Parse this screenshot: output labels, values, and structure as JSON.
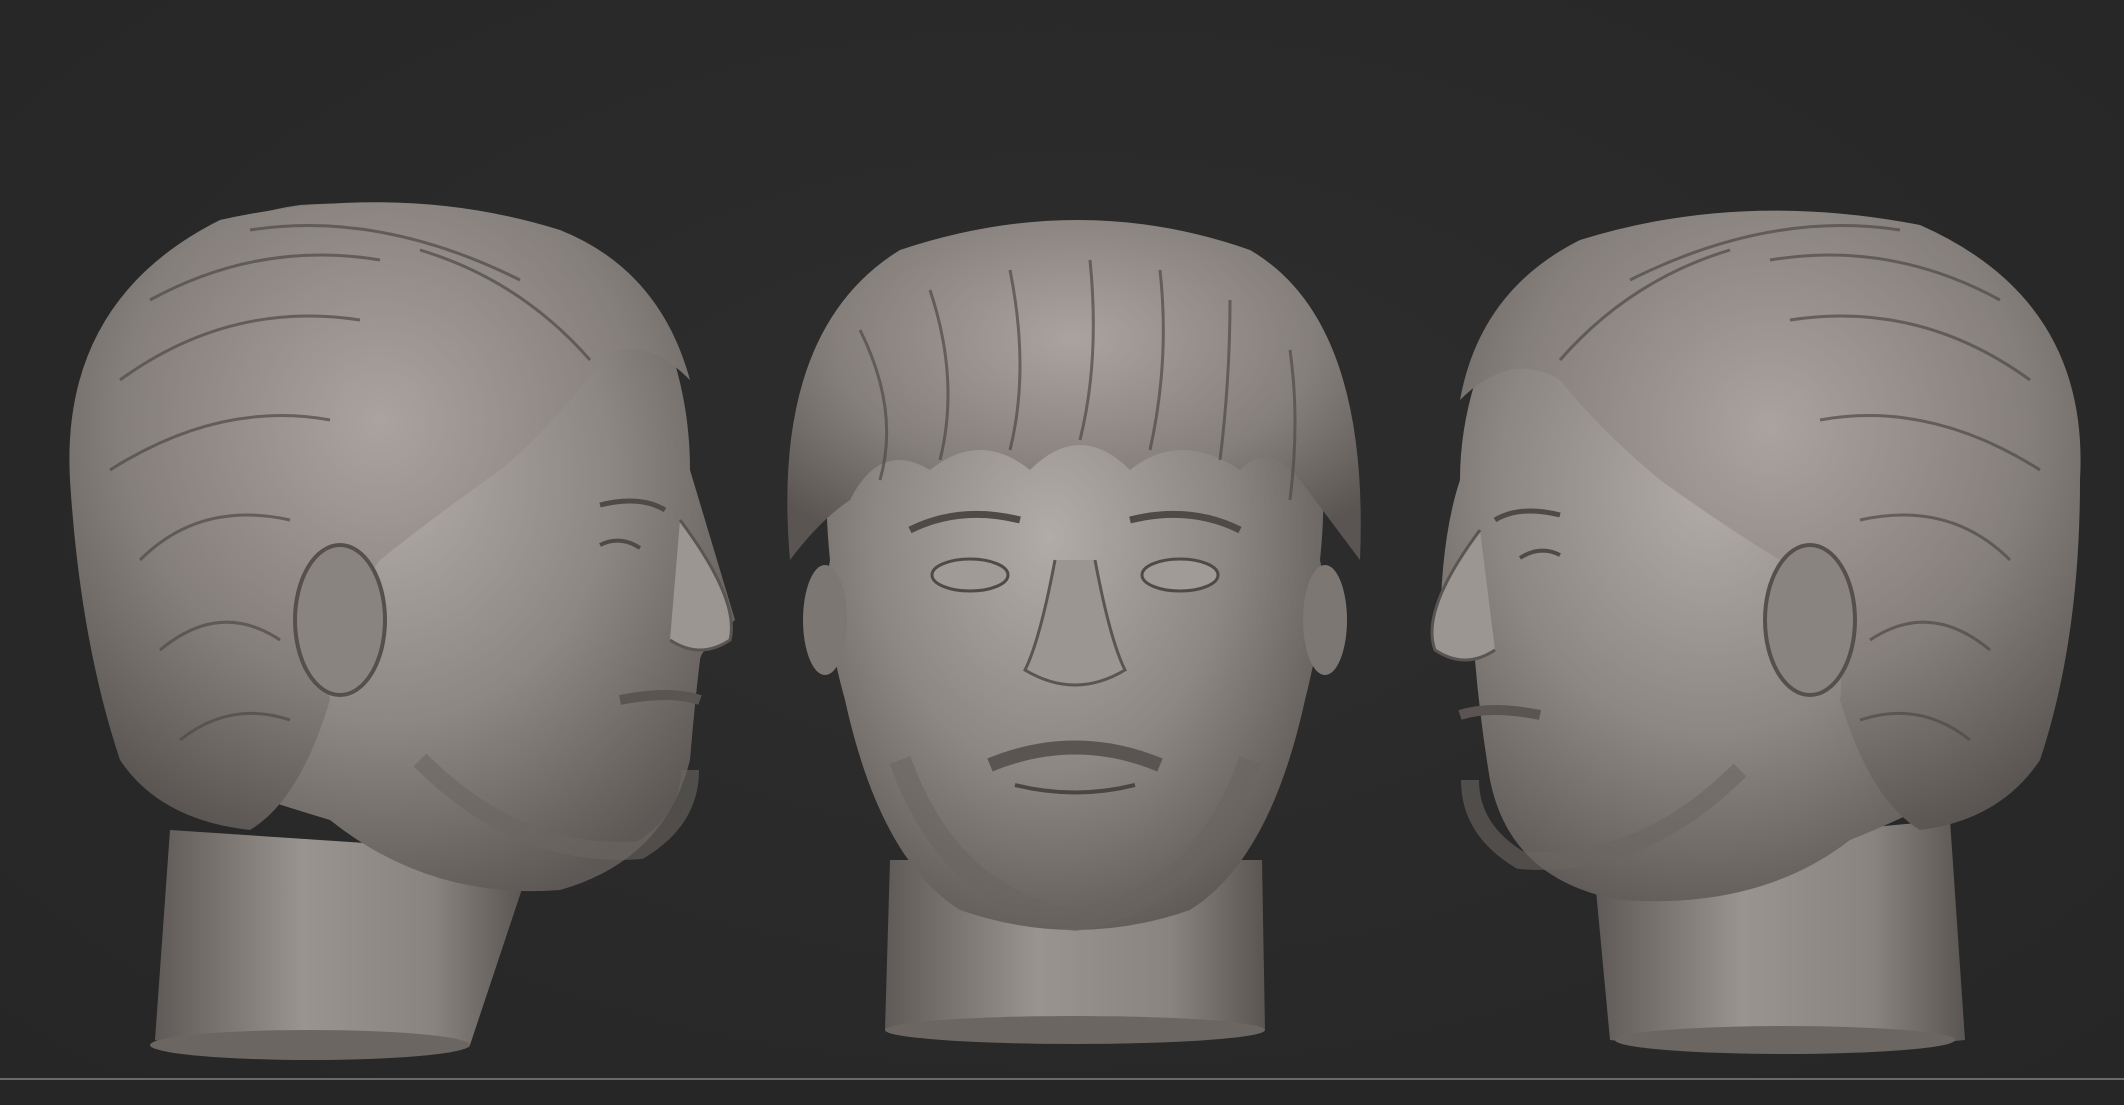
{
  "scene": {
    "description_free": true,
    "background_color": "#2a2a2a",
    "material_color": "#8e8884",
    "floor_line_color": "#6a6a6a",
    "views": [
      {
        "id": "left-profile",
        "facing": "right"
      },
      {
        "id": "front",
        "facing": "viewer"
      },
      {
        "id": "right-profile",
        "facing": "left"
      }
    ]
  }
}
